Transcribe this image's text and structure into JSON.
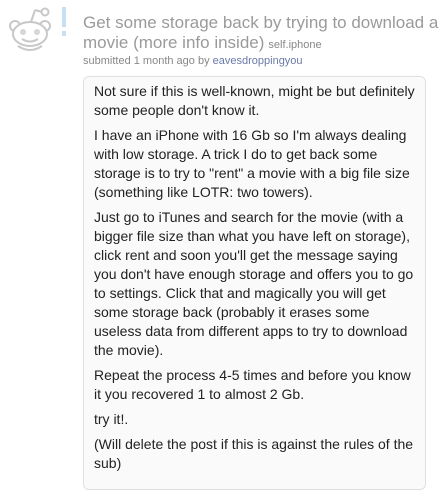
{
  "post": {
    "title": "Get some storage back by trying to download a movie (more info inside)",
    "domain": "self.iphone",
    "submitted_prefix": "submitted 1 month ago by",
    "author": "eavesdroppingyou",
    "icon": "reddit-alien-icon",
    "unread_marker_icon": "exclamation-icon",
    "body": [
      "Not sure if this is well-known, might be but definitely some people don't know it.",
      "I have an iPhone with 16 Gb so I'm always dealing with low storage. A trick I do to get back some storage is to try to \"rent\" a movie with a big file size (something like LOTR: two towers).",
      "Just go to iTunes and search for the movie (with a bigger file size than what you have left on storage), click rent and soon you'll get the message saying you don't have enough storage and offers you to go to settings. Click that and magically you will get some storage back (probably it erases some useless data from different apps to try to download the movie).",
      "Repeat the process 4-5 times and before you know it you recovered 1 to almost 2 Gb.",
      "try it!.",
      "(Will delete the post if this is against the rules of the sub)"
    ]
  },
  "colors": {
    "title": "#9a9a9a",
    "tagline": "#888888",
    "author_link": "#6a7aa8",
    "bang": "#c9dff3",
    "body_bg": "#fafafa",
    "body_border": "#e0e0e0"
  }
}
